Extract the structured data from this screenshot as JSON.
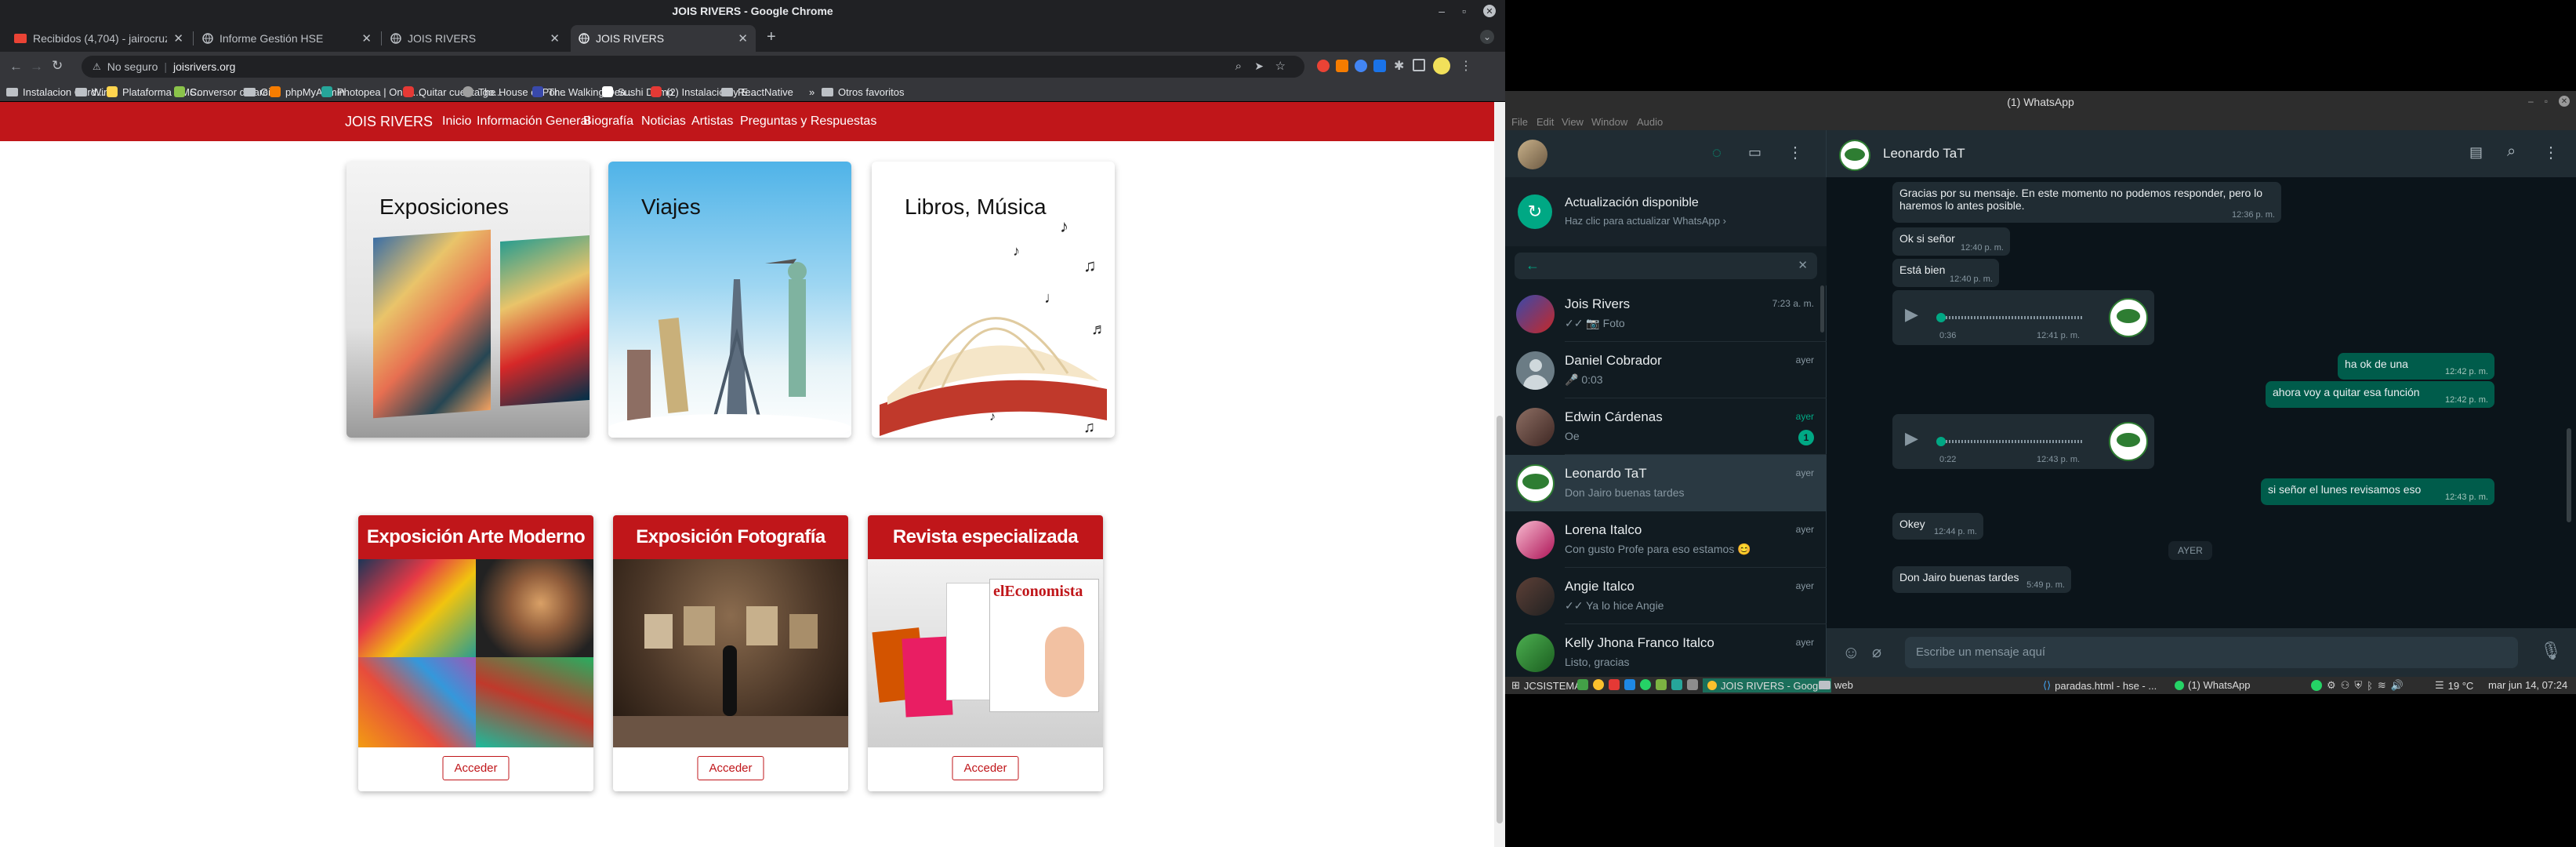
{
  "chrome": {
    "window_title": "JOIS RIVERS - Google Chrome",
    "tabs": [
      {
        "title": "Recibidos (4,704) - jairocruzo..."
      },
      {
        "title": "Informe Gestión HSE"
      },
      {
        "title": "JOIS RIVERS"
      },
      {
        "title": "JOIS RIVERS"
      }
    ],
    "security_label": "No seguro",
    "url": "joisrivers.org",
    "bookmarks": [
      "Instalacion Cord...",
      "Wine",
      "Plataforma SMS...",
      "Conversor de arc...",
      "Git",
      "phpMyAdmin",
      "Photopea | Onlin...",
      "Quitar cuenta go...",
      "The House of Por...",
      "The Walking Dea...",
      "Sushi Demo",
      "(2) Instalación y E...",
      "ReactNative"
    ],
    "other_bookmarks": "Otros favoritos",
    "colors": {
      "titlebar": "#202124",
      "toolbar": "#35363a"
    }
  },
  "site": {
    "brand": "JOIS RIVERS",
    "nav": [
      "Inicio",
      "Información General",
      "Biografía",
      "Noticias",
      "Artistas",
      "Preguntas y Respuestas"
    ],
    "hero_cards": [
      {
        "title": "Exposiciones"
      },
      {
        "title": "Viajes"
      },
      {
        "title": "Libros, Música"
      }
    ],
    "cards": [
      {
        "title": "Exposición Arte Moderno",
        "button": "Acceder"
      },
      {
        "title": "Exposición Fotografía",
        "button": "Acceder"
      },
      {
        "title": "Revista especializada",
        "button": "Acceder"
      }
    ],
    "accent": "#c0161a"
  },
  "whatsapp": {
    "window_title": "(1) WhatsApp",
    "menu": [
      "File",
      "Edit",
      "View",
      "Window",
      "Audio"
    ],
    "update": {
      "title": "Actualización disponible",
      "subtitle": "Haz clic para actualizar WhatsApp ›"
    },
    "chats": [
      {
        "name": "Jois Rivers",
        "preview": "✓✓ 📷 Foto",
        "time": "7:23 a. m."
      },
      {
        "name": "Daniel Cobrador",
        "preview": "🎤 0:03",
        "time": "ayer"
      },
      {
        "name": "Edwin Cárdenas",
        "preview": "Oe",
        "time": "ayer",
        "unread": "1"
      },
      {
        "name": "Leonardo TaT",
        "preview": "Don Jairo buenas tardes",
        "time": "ayer"
      },
      {
        "name": "Lorena Italco",
        "preview": "Con gusto Profe para eso estamos 😊",
        "time": "ayer"
      },
      {
        "name": "Angie Italco",
        "preview": "✓✓ Ya lo hice Angie",
        "time": "ayer"
      },
      {
        "name": "Kelly Jhona Franco Italco",
        "preview": "Listo, gracias",
        "time": "ayer"
      }
    ],
    "active_contact": "Leonardo TaT",
    "messages": [
      {
        "dir": "in",
        "text": "Gracias por su mensaje. En este momento no podemos responder, pero lo haremos lo antes posible.",
        "time": "12:36 p. m."
      },
      {
        "dir": "in",
        "text": "Ok si señor",
        "time": "12:40 p. m."
      },
      {
        "dir": "in",
        "text": "Está bien",
        "time": "12:40 p. m."
      },
      {
        "dir": "in",
        "audio": true,
        "duration": "0:36",
        "time": "12:41 p. m."
      },
      {
        "dir": "out",
        "text": "ha ok de una",
        "time": "12:42 p. m."
      },
      {
        "dir": "out",
        "text": "ahora voy a quitar esa función",
        "time": "12:42 p. m."
      },
      {
        "dir": "in",
        "audio": true,
        "duration": "0:22",
        "time": "12:43 p. m."
      },
      {
        "dir": "out",
        "text": "si señor el lunes revisamos eso",
        "time": "12:43 p. m."
      },
      {
        "dir": "in",
        "text": "Okey",
        "time": "12:44 p. m."
      },
      {
        "dir": "in",
        "text": "Don Jairo buenas tardes",
        "time": "5:49 p. m."
      }
    ],
    "day_divider": "AYER",
    "compose_placeholder": "Escribe un mensaje aquí",
    "colors": {
      "bg": "#0b141a",
      "panel": "#202c33",
      "outgoing": "#005c4b",
      "accent": "#00a884"
    }
  },
  "taskbar": {
    "start": "JCSISTEMAS",
    "items": [
      "JOIS RIVERS - Goog...",
      "web",
      "paradas.html - hse - ...",
      "(1) WhatsApp"
    ],
    "temperature": "19 °C",
    "clock": "mar jun 14, 07:24"
  }
}
